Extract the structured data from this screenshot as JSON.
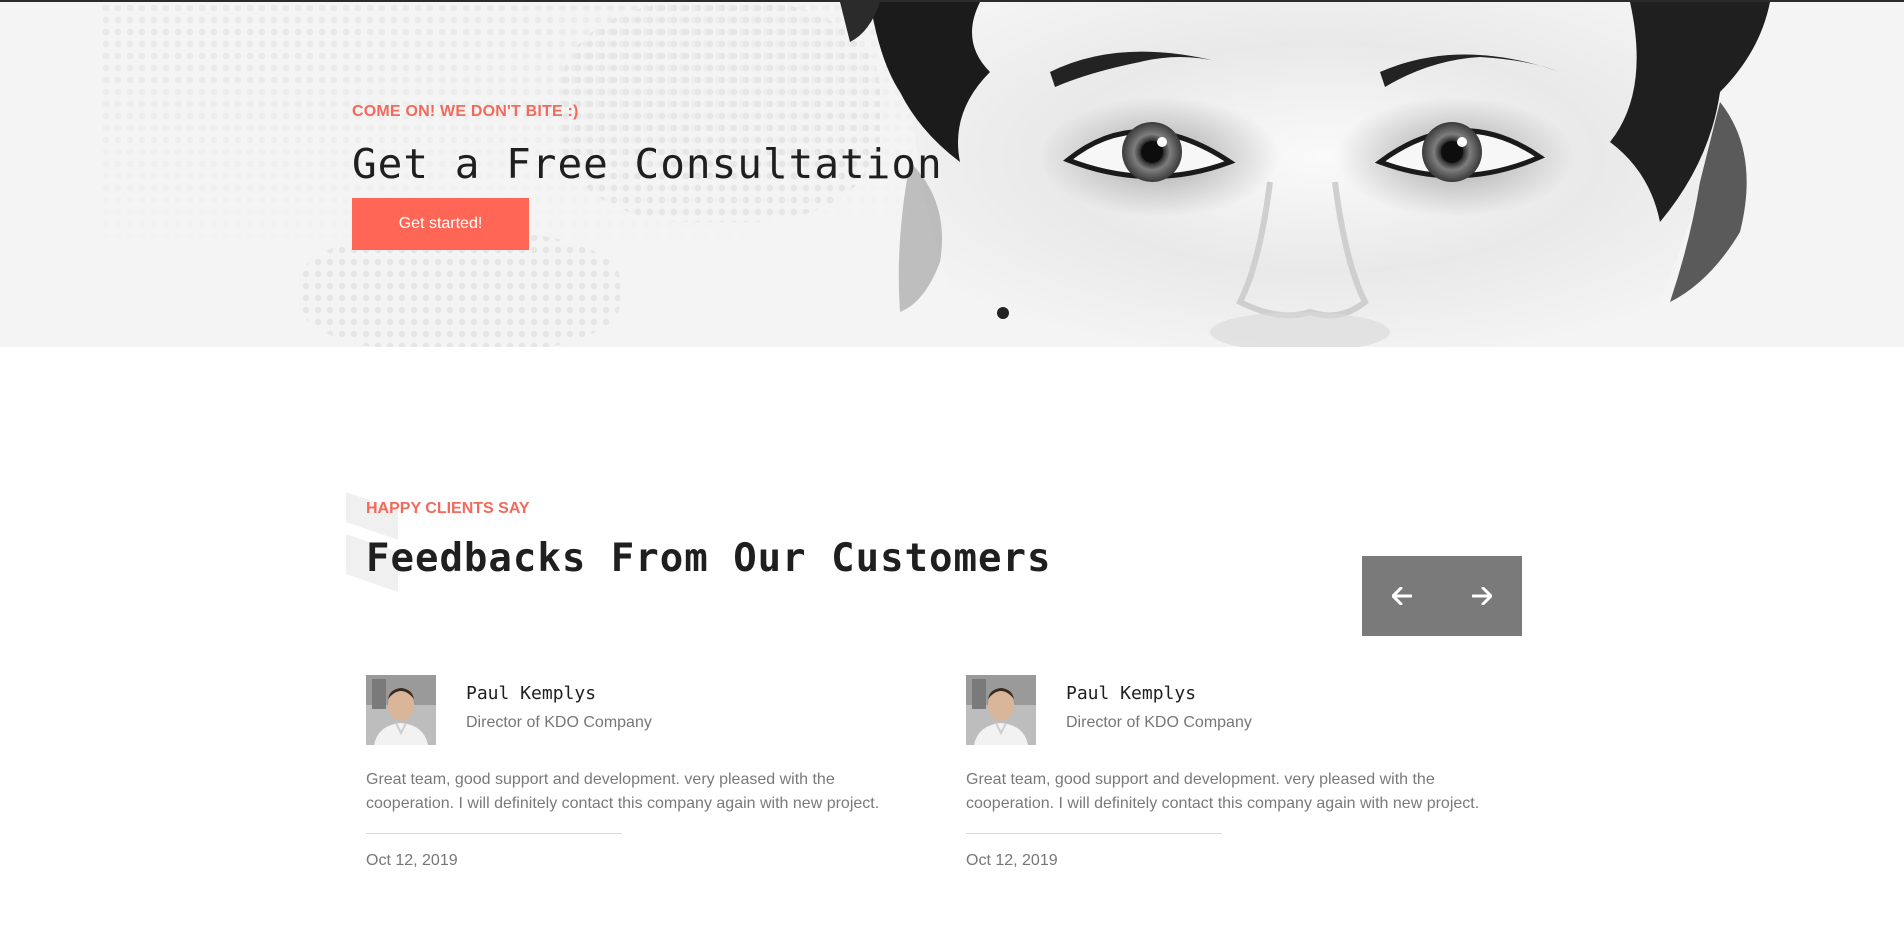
{
  "hero": {
    "kicker": "COME ON! WE DON'T BITE :)",
    "title": "Get a Free Consultation",
    "cta_label": "Get started!",
    "accent_color": "#ff6656",
    "image": "grayscale-woman-face-artwork"
  },
  "testimonials": {
    "kicker": "HAPPY CLIENTS SAY",
    "title": "Feedbacks From Our Customers",
    "nav": {
      "prev_icon": "arrow-left-icon",
      "next_icon": "arrow-right-icon",
      "color": "#7a7a7a"
    },
    "items": [
      {
        "name": "Paul Kemplys",
        "role": "Director of KDO Company",
        "quote": "Great team, good support and development. very pleased with the cooperation. I will definitely contact this company again with new project.",
        "date": "Oct 12, 2019"
      },
      {
        "name": "Paul Kemplys",
        "role": "Director of KDO Company",
        "quote": "Great team, good support and development. very pleased with the cooperation. I will definitely contact this company again with new project.",
        "date": "Oct 12, 2019"
      }
    ]
  }
}
